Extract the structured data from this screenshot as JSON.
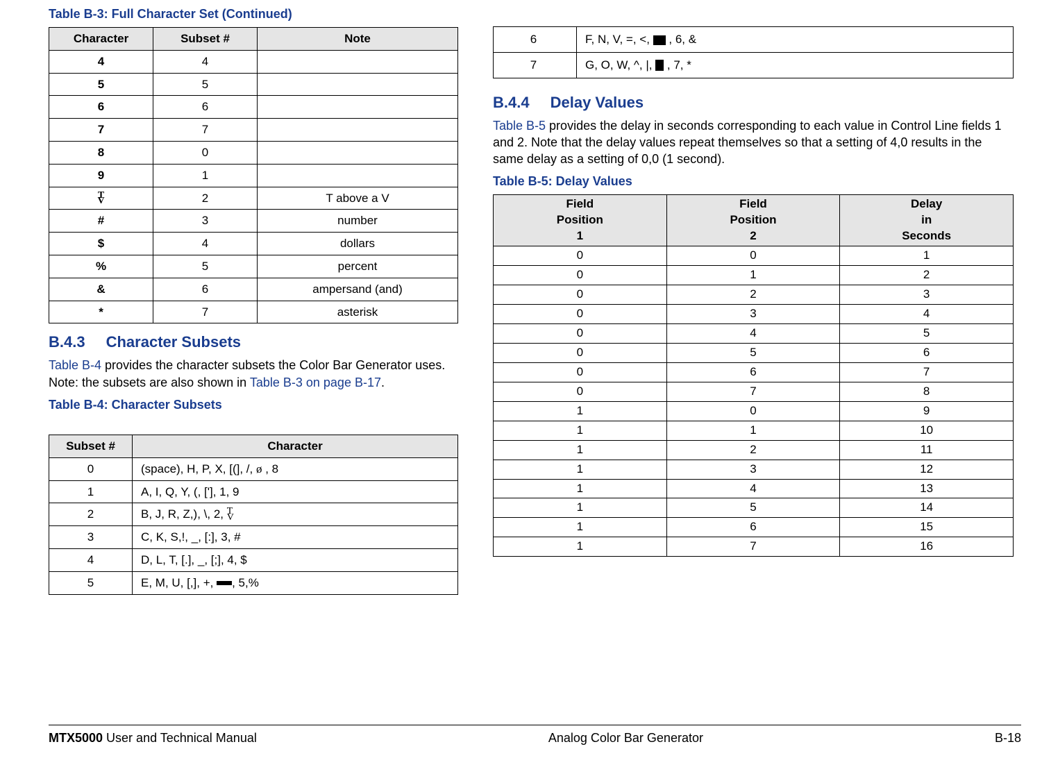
{
  "tableB3": {
    "title": "Table B-3:   Full Character Set (Continued)",
    "headers": [
      "Character",
      "Subset #",
      "Note"
    ],
    "rows": [
      {
        "char": "4",
        "subset": "4",
        "note": ""
      },
      {
        "char": "5",
        "subset": "5",
        "note": ""
      },
      {
        "char": "6",
        "subset": "6",
        "note": ""
      },
      {
        "char": "7",
        "subset": "7",
        "note": ""
      },
      {
        "char": "8",
        "subset": "0",
        "note": ""
      },
      {
        "char": "9",
        "subset": "1",
        "note": ""
      },
      {
        "char": "TV",
        "subset": "2",
        "note": "T above a V"
      },
      {
        "char": "#",
        "subset": "3",
        "note": "number"
      },
      {
        "char": "$",
        "subset": "4",
        "note": "dollars"
      },
      {
        "char": "%",
        "subset": "5",
        "note": "percent"
      },
      {
        "char": "&",
        "subset": "6",
        "note": "ampersand (and)"
      },
      {
        "char": "*",
        "subset": "7",
        "note": "asterisk"
      }
    ]
  },
  "sectionB43": {
    "num": "B.4.3",
    "title": "Character Subsets",
    "para_pre": "",
    "para_link1": "Table B-4",
    "para_mid": " provides the character subsets the Color Bar Generator uses.  Note: the subsets are also shown in ",
    "para_link2": "Table B-3 on page B-17",
    "para_end": "."
  },
  "tableB4": {
    "title": "Table B-4:   Character Subsets",
    "headers": [
      "Subset #",
      "Character"
    ],
    "rows": [
      {
        "subset": "0",
        "chars_pre": "(space), H, P, X, [(], /,  ",
        "chars_post": " , 8",
        "sym": "slashzero"
      },
      {
        "subset": "1",
        "chars": "A, I, Q, Y, (, ['], 1, 9"
      },
      {
        "subset": "2",
        "chars_pre": "B, J, R, Z,), \\, 2, ",
        "sym": "tv",
        "chars_post": ""
      },
      {
        "subset": "3",
        "chars": "C, K, S,!, _, [:], 3, #"
      },
      {
        "subset": "4",
        "chars": "D, L, T, [.], _, [;], 4, $"
      },
      {
        "subset": "5",
        "chars_pre": "E, M, U, [,], +, ",
        "sym": "bar",
        "chars_post": ", 5,%"
      }
    ]
  },
  "tableB4cont": {
    "rows": [
      {
        "subset": "6",
        "chars_pre": "F, N, V, =, <,  ",
        "sym": "block",
        "chars_post": " , 6, &"
      },
      {
        "subset": "7",
        "chars_pre": "G, O, W, ^, |,  ",
        "sym": "blocktall",
        "chars_post": " , 7, *"
      }
    ]
  },
  "sectionB44": {
    "num": "B.4.4",
    "title": "Delay Values",
    "para_link": "Table B-5",
    "para_rest": " provides the delay in seconds corresponding to each value in Control Line fields 1 and 2.  Note that the delay values repeat themselves so that a setting of 4,0 results in the same delay as a setting of 0,0 (1 second)."
  },
  "tableB5": {
    "title": "Table B-5:   Delay Values",
    "headers": [
      "Field\nPosition\n1",
      "Field\nPosition\n2",
      "Delay\nin\nSeconds"
    ],
    "rows": [
      [
        "0",
        "0",
        "1"
      ],
      [
        "0",
        "1",
        "2"
      ],
      [
        "0",
        "2",
        "3"
      ],
      [
        "0",
        "3",
        "4"
      ],
      [
        "0",
        "4",
        "5"
      ],
      [
        "0",
        "5",
        "6"
      ],
      [
        "0",
        "6",
        "7"
      ],
      [
        "0",
        "7",
        "8"
      ],
      [
        "1",
        "0",
        "9"
      ],
      [
        "1",
        "1",
        "10"
      ],
      [
        "1",
        "2",
        "11"
      ],
      [
        "1",
        "3",
        "12"
      ],
      [
        "1",
        "4",
        "13"
      ],
      [
        "1",
        "5",
        "14"
      ],
      [
        "1",
        "6",
        "15"
      ],
      [
        "1",
        "7",
        "16"
      ]
    ]
  },
  "footer": {
    "product": "MTX5000",
    "manual": " User and Technical Manual",
    "center": "Analog Color Bar Generator",
    "page": "B-18"
  }
}
